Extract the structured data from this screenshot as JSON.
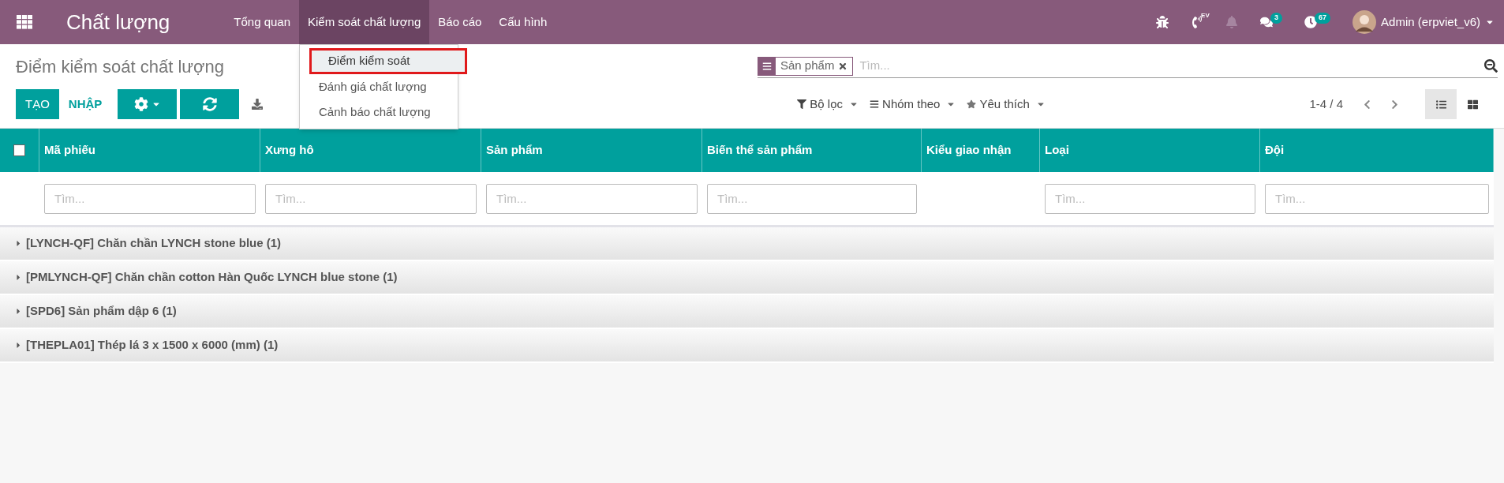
{
  "navbar": {
    "app_title": "Chất lượng",
    "menus": [
      {
        "label": "Tổng quan",
        "selected": false
      },
      {
        "label": "Kiểm soát chất lượng",
        "selected": true
      },
      {
        "label": "Báo cáo",
        "selected": false
      },
      {
        "label": "Cấu hình",
        "selected": false
      }
    ],
    "dropdown": [
      {
        "label": "Điểm kiểm soát",
        "selected": true
      },
      {
        "label": "Đánh giá chất lượng",
        "selected": false
      },
      {
        "label": "Cảnh báo chất lượng",
        "selected": false
      }
    ],
    "phone_label": "EV",
    "chat_count": "3",
    "activity_count": "67",
    "user": "Admin (erpviet_v6)"
  },
  "control_panel": {
    "title": "Điểm kiểm soát chất lượng",
    "create_label": "TẠO",
    "import_label": "NHẬP",
    "search": {
      "facet": "Sản phẩm",
      "placeholder": "Tìm..."
    },
    "filters": [
      "Bộ lọc",
      "Nhóm theo",
      "Yêu thích"
    ],
    "pager": "1-4 / 4",
    "views": [
      {
        "kind": "list",
        "selected": true
      },
      {
        "kind": "kanban",
        "selected": false
      }
    ]
  },
  "table": {
    "select_all": {
      "checked": false
    },
    "columns": [
      {
        "label": "Mã phiếu",
        "placeholder": "Tìm..."
      },
      {
        "label": "Xưng hô",
        "placeholder": "Tìm..."
      },
      {
        "label": "Sản phẩm",
        "placeholder": "Tìm..."
      },
      {
        "label": "Biến thể sản phẩm",
        "placeholder": "Tìm..."
      },
      {
        "label": "Kiểu giao nhận"
      },
      {
        "label": "Loại",
        "placeholder": "Tìm..."
      },
      {
        "label": "Đội",
        "placeholder": "Tìm..."
      }
    ],
    "groups": [
      {
        "label": "[LYNCH-QF] Chăn chần LYNCH stone blue (1)",
        "expanded": false
      },
      {
        "label": "[PMLYNCH-QF] Chăn chần cotton Hàn Quốc LYNCH blue stone (1)",
        "expanded": false
      },
      {
        "label": "[SPD6] Sản phẩm dập 6 (1)",
        "expanded": false
      },
      {
        "label": "[THEPLA01] Thép lá 3 x 1500 x 6000 (mm) (1)",
        "expanded": false
      }
    ]
  }
}
